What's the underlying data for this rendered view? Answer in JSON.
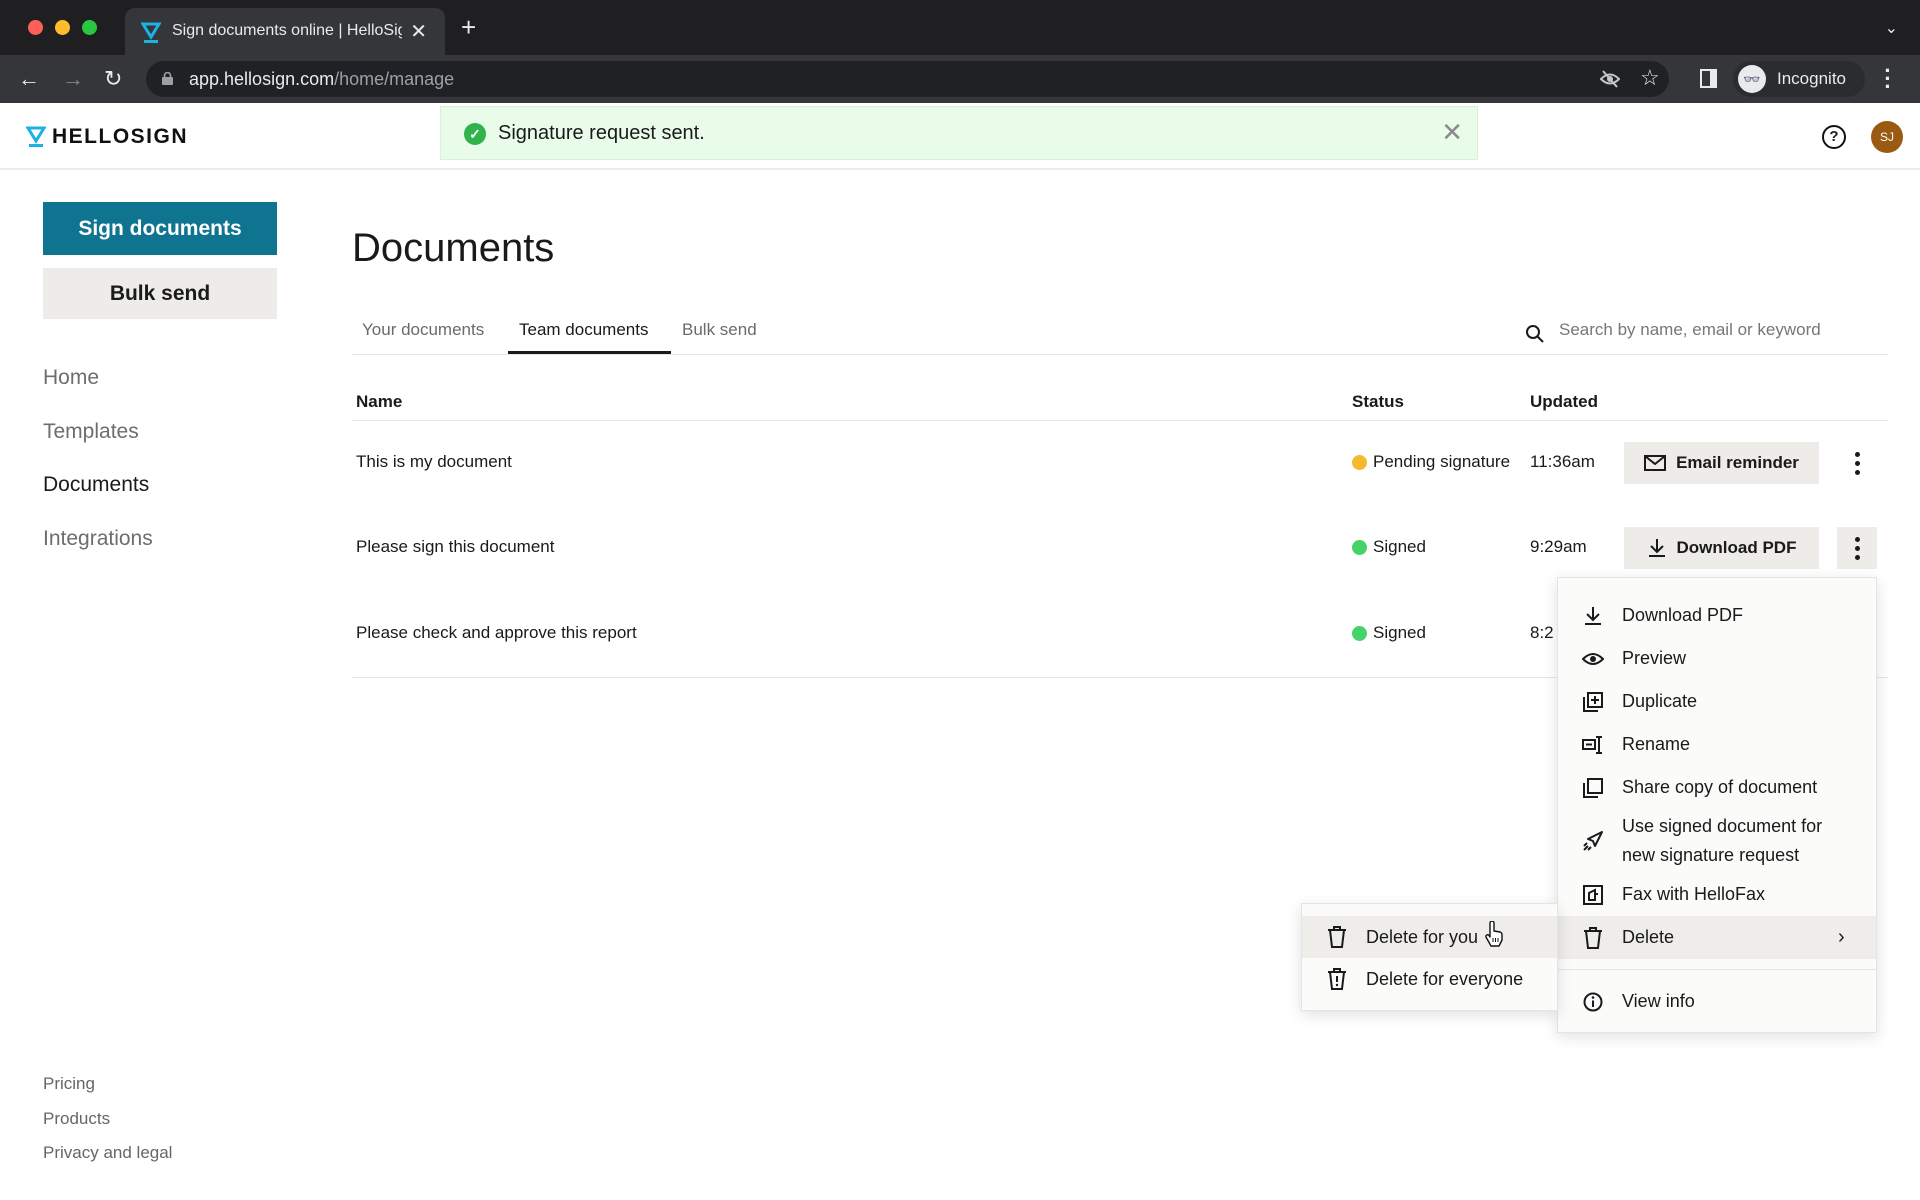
{
  "browser": {
    "tab_title": "Sign documents online | HelloSign",
    "url_host": "app.hellosign.com",
    "url_path": "/home/manage",
    "profile_label": "Incognito"
  },
  "app": {
    "logo_text": "HELLOSIGN",
    "avatar_initials": "SJ",
    "colors": {
      "primary": "#0f7490",
      "secondary_button": "#eeece8",
      "success": "#2fb34a",
      "pending": "#f5b92e",
      "signed": "#45d269",
      "toast_bg": "#e9fbe9",
      "avatar": "#9b5a12"
    }
  },
  "toast": {
    "message": "Signature request sent.",
    "icon": "check-circle-icon"
  },
  "sidebar": {
    "primary_button": "Sign documents",
    "secondary_button": "Bulk send",
    "nav": [
      {
        "label": "Home",
        "active": false
      },
      {
        "label": "Templates",
        "active": false
      },
      {
        "label": "Documents",
        "active": true
      },
      {
        "label": "Integrations",
        "active": false
      }
    ],
    "footer_links": [
      "Pricing",
      "Products",
      "Privacy and legal"
    ]
  },
  "main": {
    "title": "Documents",
    "tabs": [
      {
        "label": "Your documents",
        "active": false
      },
      {
        "label": "Team documents",
        "active": true
      },
      {
        "label": "Bulk send",
        "active": false
      }
    ],
    "search": {
      "placeholder": "Search by name, email or keyword",
      "value": ""
    },
    "table": {
      "columns": [
        "Name",
        "Status",
        "Updated"
      ],
      "rows": [
        {
          "name": "This is my document",
          "status": "Pending signature",
          "status_color": "#f5b92e",
          "updated": "11:36am",
          "action": "Email reminder",
          "action_icon": "mail-icon"
        },
        {
          "name": "Please sign this document",
          "status": "Signed",
          "status_color": "#45d269",
          "updated": "9:29am",
          "action": "Download PDF",
          "action_icon": "download-icon"
        },
        {
          "name": "Please check and approve this report",
          "status": "Signed",
          "status_color": "#45d269",
          "updated": "8:2"
        }
      ]
    }
  },
  "context_menu": {
    "items": [
      {
        "label": "Download PDF",
        "icon": "download-icon"
      },
      {
        "label": "Preview",
        "icon": "eye-icon"
      },
      {
        "label": "Duplicate",
        "icon": "duplicate-icon"
      },
      {
        "label": "Rename",
        "icon": "rename-icon"
      },
      {
        "label": "Share copy of document",
        "icon": "share-copy-icon"
      },
      {
        "label_line1": "Use signed document for",
        "label_line2": "new signature request",
        "icon": "send-icon"
      },
      {
        "label": "Fax with HelloFax",
        "icon": "fax-icon"
      },
      {
        "label": "Delete",
        "icon": "trash-icon",
        "has_submenu": true
      },
      {
        "label": "View info",
        "icon": "info-icon"
      }
    ]
  },
  "submenu": {
    "items": [
      {
        "label": "Delete for you",
        "icon": "trash-icon"
      },
      {
        "label": "Delete for everyone",
        "icon": "trash-alert-icon"
      }
    ]
  }
}
